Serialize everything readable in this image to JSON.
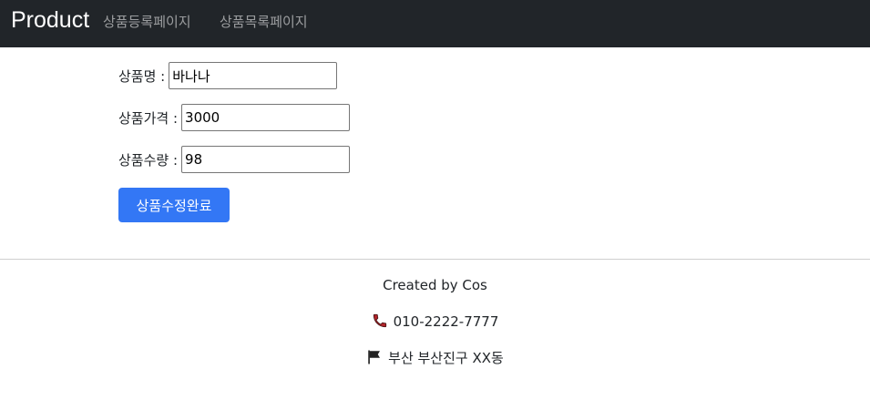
{
  "navbar": {
    "brand": "Product",
    "links": [
      "상품등록페이지",
      "상품목록페이지"
    ]
  },
  "form": {
    "name_label": "상품명 :",
    "name_value": "바나나",
    "price_label": "상품가격 :",
    "price_value": "3000",
    "qty_label": "상품수량 :",
    "qty_value": "98",
    "submit_label": "상품수정완료"
  },
  "footer": {
    "created_by": "Created by Cos",
    "phone": "010-2222-7777",
    "address": "부산 부산진구 XX동"
  },
  "colors": {
    "navbar_bg": "#212529",
    "primary": "#3377f5",
    "phone_icon": "#b0242a"
  },
  "icons": {
    "phone": "phone-icon",
    "address": "flag-icon"
  }
}
